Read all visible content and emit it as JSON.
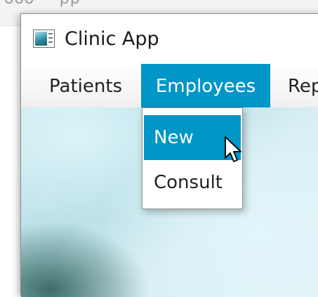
{
  "app": {
    "title": "Clinic App"
  },
  "menubar": {
    "items": [
      {
        "label": "Patients"
      },
      {
        "label": "Employees"
      },
      {
        "label": "Rep"
      }
    ]
  },
  "dropdown": {
    "items": [
      {
        "label": "New"
      },
      {
        "label": "Consult"
      }
    ]
  },
  "colors": {
    "accent": "#0096c7",
    "menu_highlight_text": "#ffffff"
  },
  "icons": {
    "app": "app-window-icon",
    "cursor": "mouse-pointer-icon"
  }
}
